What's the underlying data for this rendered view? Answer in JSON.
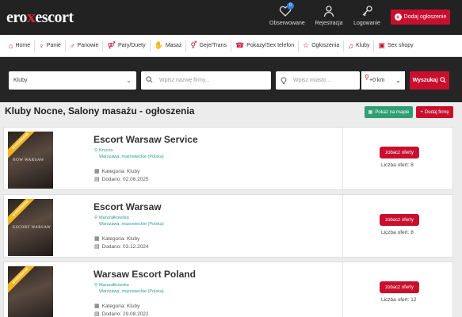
{
  "header": {
    "logo_pre": "ero",
    "logo_x": "x",
    "logo_post": "escort",
    "favorites_label": "Obserwowane",
    "favorites_count": "0",
    "register_label": "Rejestracja",
    "login_label": "Logowanie",
    "add_ad_label": "Dodaj ogłoszenie"
  },
  "categories": [
    {
      "label": "Home",
      "icon": "⌂"
    },
    {
      "label": "Panie",
      "icon": "♀"
    },
    {
      "label": "Panowie",
      "icon": "♂"
    },
    {
      "label": "Pary/Duety",
      "icon": "⚤"
    },
    {
      "label": "Masaż",
      "icon": "✋"
    },
    {
      "label": "Geje/Trans",
      "icon": "⚥"
    },
    {
      "label": "Pokazy/Sex telefon",
      "icon": "☎"
    },
    {
      "label": "Ogłoszenia",
      "icon": "☆"
    },
    {
      "label": "Kluby",
      "icon": "♫"
    },
    {
      "label": "Sex shopy",
      "icon": "▣"
    }
  ],
  "search": {
    "category_value": "Kluby",
    "company_placeholder": "Wpisz nazwę firmy...",
    "city_placeholder": "Wpisz miasto...",
    "radius_value": "+0 km",
    "search_button": "Wyszukaj"
  },
  "page": {
    "title": "Kluby Nocne, Salony masażu - ogłoszenia",
    "map_button": "Pokaż na mapie",
    "add_firm_button": "Dodaj firmę"
  },
  "listings": [
    {
      "name": "Escort Warsaw Service",
      "district": "Kruczа",
      "region": "Warszawa, mazowieckie (Polska)",
      "category_label": "Kategoria: Kluby",
      "added_label": "Dodano: 02.06.2025",
      "offer_button": "zobacz oferty",
      "offer_count_label": "Liczba ofert: 8",
      "ribbon": "WYRÓŻNIONE",
      "thumb_text": "NOW WARSAW"
    },
    {
      "name": "Escort Warsaw",
      "district": "Marszałkowska",
      "region": "Warszawa, mazowieckie (Polska)",
      "category_label": "Kategoria: Kluby",
      "added_label": "Dodano: 03.12.2024",
      "offer_button": "zobacz oferty",
      "offer_count_label": "Liczba ofert: 8",
      "ribbon": "WYRÓŻNIONE",
      "thumb_text": "ESCORT WARSAW"
    },
    {
      "name": "Warsaw Escort Poland",
      "district": "Marszałkowska",
      "region": "Warszawa, mazowieckie (Polska)",
      "category_label": "Kategoria: Kluby",
      "added_label": "Dodano: 29.08.2022",
      "offer_button": "zobacz oferty",
      "offer_count_label": "Liczba ofert: 12",
      "ribbon": "WYRÓŻNIONE",
      "thumb_text": ""
    }
  ],
  "colors": {
    "accent": "#c8102e",
    "map_green": "#2f9e76",
    "location_teal": "#2a9d8f",
    "header_bg": "#222222"
  }
}
